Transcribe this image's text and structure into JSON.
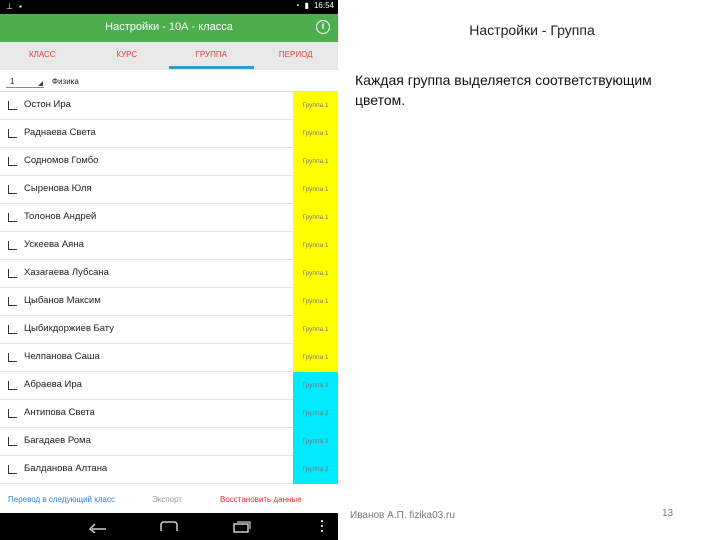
{
  "colors": {
    "appbar": "#4cae4c",
    "tab_text": "#e04040",
    "tab_indicator": "#2f9bd3",
    "group1": "#ffff00",
    "group2": "#00eaff"
  },
  "statusbar": {
    "time": "16:54"
  },
  "appbar": {
    "title": "Настройки - 10А - класса",
    "info_icon": "info-icon"
  },
  "tabs": [
    {
      "label": "КЛАСС"
    },
    {
      "label": "КУРС"
    },
    {
      "label": "ГРУППА",
      "active": true
    },
    {
      "label": "ПЕРИОД"
    }
  ],
  "filter": {
    "number": "1",
    "subject": "Физика"
  },
  "students": [
    {
      "name": "Остон Ира",
      "group": "Группа 1",
      "color": "group1"
    },
    {
      "name": "Раднаева Света",
      "group": "Группа 1",
      "color": "group1"
    },
    {
      "name": "Содномов Гомбо",
      "group": "Группа 1",
      "color": "group1"
    },
    {
      "name": "Сыренова Юля",
      "group": "Группа 1",
      "color": "group1"
    },
    {
      "name": "Толонов Андрей",
      "group": "Группа 1",
      "color": "group1"
    },
    {
      "name": "Ускеева Аяна",
      "group": "Группа 1",
      "color": "group1"
    },
    {
      "name": "Хазагаева Лубсана",
      "group": "Группа 1",
      "color": "group1"
    },
    {
      "name": "Цыбанов Максим",
      "group": "Группа 1",
      "color": "group1"
    },
    {
      "name": "Цыбикдоржиев Бату",
      "group": "Группа 1",
      "color": "group1"
    },
    {
      "name": "Челпанова Саша",
      "group": "Группа 1",
      "color": "group1"
    },
    {
      "name": "Абраева Ира",
      "group": "Группа 2",
      "color": "group2"
    },
    {
      "name": "Антипова Света",
      "group": "Группа 2",
      "color": "group2"
    },
    {
      "name": "Багадаев Рома",
      "group": "Группа 2",
      "color": "group2"
    },
    {
      "name": "Балданова Алтана",
      "group": "Группа 2",
      "color": "group2"
    }
  ],
  "actions": {
    "next": "Перевод в следующий класс",
    "export": "Экспорт",
    "restore": "Восстановить данные"
  },
  "slide": {
    "title": "Настройки - Группа",
    "body": "Каждая группа выделяется соответствующим цветом.",
    "author": "Иванов А.П. fizika03.ru",
    "page": "13"
  }
}
